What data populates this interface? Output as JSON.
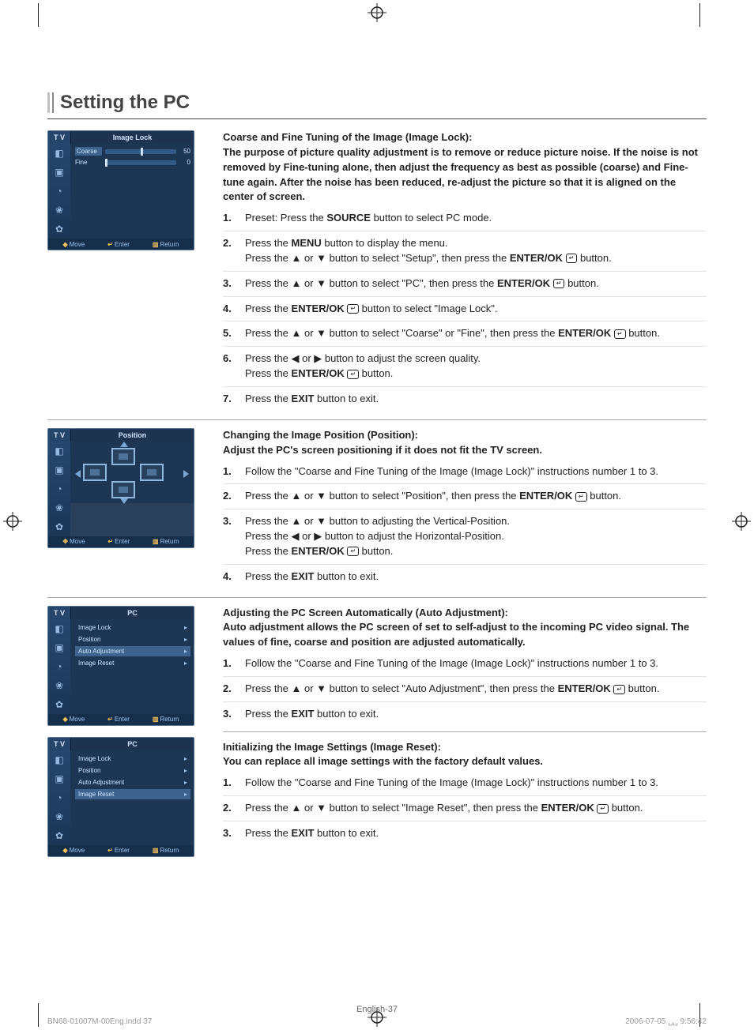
{
  "page": {
    "title": "Setting the PC",
    "footer": "English-37",
    "indd": "BN68-01007M-00Eng.indd   37",
    "timestamp": "2006-07-05   ␣␣ 9:56:42"
  },
  "glyphs": {
    "up": "▲",
    "down": "▼",
    "left": "◀",
    "right": "▶",
    "enter": "↵"
  },
  "tv_common": {
    "tv_label": "T V",
    "foot_move_ud": "Move",
    "foot_move_all": "Move",
    "foot_enter": "Enter",
    "foot_return": "Return",
    "foot_move_sym_ud": "◆",
    "foot_move_sym_all": "✥",
    "foot_enter_sym": "↵",
    "foot_return_sym": "▥"
  },
  "tv1": {
    "title": "Image Lock",
    "rows": [
      {
        "label": "Coarse",
        "value": "50",
        "pos": 50,
        "selected": true
      },
      {
        "label": "Fine",
        "value": "0",
        "pos": 0,
        "selected": false
      }
    ]
  },
  "tv2": {
    "title": "Position"
  },
  "tv3": {
    "title": "PC",
    "items": [
      {
        "label": "Image Lock",
        "selected": false
      },
      {
        "label": "Position",
        "selected": false
      },
      {
        "label": "Auto Adjustment",
        "selected": true
      },
      {
        "label": "Image Reset",
        "selected": false
      }
    ]
  },
  "tv4": {
    "title": "PC",
    "items": [
      {
        "label": "Image Lock",
        "selected": false
      },
      {
        "label": "Position",
        "selected": false
      },
      {
        "label": "Auto Adjustment",
        "selected": false
      },
      {
        "label": "Image Reset",
        "selected": true
      }
    ]
  },
  "sections": [
    {
      "heading": "Coarse and Fine Tuning of the Image (Image Lock):",
      "intro": "The purpose of picture quality adjustment is to remove or reduce picture noise. If the noise is not removed by Fine-tuning alone, then adjust the frequency as best as possible (coarse) and Fine-tune again. After the noise has been reduced, re-adjust the picture so that it is aligned on the center of screen.",
      "steps": [
        {
          "pre": "Preset: Press the ",
          "bold": "SOURCE",
          "post": " button to select PC mode."
        },
        {
          "lines": [
            {
              "pre": "Press the ",
              "bold": "MENU",
              "post": " button to display the menu."
            },
            {
              "pre": "Press the ▲ or ▼ button to select \"Setup\", then press the ",
              "bold": "ENTER/OK",
              "enter": true,
              "post": " button."
            }
          ]
        },
        {
          "pre": "Press the ▲ or ▼ button to select \"PC\", then press the ",
          "bold": "ENTER/OK",
          "enter": true,
          "post": " button."
        },
        {
          "pre": "Press the ",
          "bold": "ENTER/OK",
          "enter": true,
          "post": " button to select \"Image Lock\"."
        },
        {
          "pre": "Press the ▲ or ▼ button to select \"Coarse\" or \"Fine\", then press the ",
          "bold": "ENTER/OK",
          "enter": true,
          "post": " button."
        },
        {
          "lines": [
            {
              "pre": "Press the ◀ or ▶ button to adjust the screen quality."
            },
            {
              "pre": "Press the ",
              "bold": "ENTER/OK",
              "enter": true,
              "post": " button."
            }
          ]
        },
        {
          "pre": "Press the ",
          "bold": "EXIT",
          "post": " button to exit."
        }
      ]
    },
    {
      "heading": "Changing the Image Position (Position):",
      "intro": "Adjust the PC's screen positioning if it does not fit the TV screen.",
      "steps": [
        {
          "pre": "Follow the \"Coarse and Fine Tuning of the Image (Image Lock)\" instructions number 1 to 3."
        },
        {
          "pre": "Press the ▲ or ▼ button to select \"Position\", then press the ",
          "bold": "ENTER/OK",
          "enter": true,
          "post": " button."
        },
        {
          "lines": [
            {
              "pre": "Press the ▲ or ▼ button to adjusting the Vertical-Position."
            },
            {
              "pre": "Press the ◀ or ▶ button to adjust the Horizontal-Position."
            },
            {
              "pre": "Press the ",
              "bold": "ENTER/OK",
              "enter": true,
              "post": " button."
            }
          ]
        },
        {
          "pre": "Press the ",
          "bold": "EXIT",
          "post": " button to exit."
        }
      ]
    },
    {
      "heading": "Adjusting the PC Screen Automatically (Auto Adjustment):",
      "intro": "Auto adjustment allows the PC screen of set to self-adjust to the incoming PC video signal. The values of fine, coarse and position are adjusted automatically.",
      "steps": [
        {
          "pre": "Follow the \"Coarse and Fine Tuning of the Image (Image Lock)\" instructions number 1 to 3."
        },
        {
          "pre": "Press the ▲ or ▼ button to select \"Auto Adjustment\", then press the ",
          "bold": "ENTER/OK",
          "enter": true,
          "post": " button."
        },
        {
          "pre": "Press the ",
          "bold": "EXIT",
          "post": " button to exit."
        }
      ]
    },
    {
      "heading": "Initializing the Image Settings (Image Reset):",
      "intro": "You can replace all image settings with the factory default values.",
      "steps": [
        {
          "pre": "Follow the \"Coarse and Fine Tuning of the Image (Image Lock)\" instructions number 1 to 3."
        },
        {
          "pre": "Press the ▲ or ▼ button to select \"Image Reset\", then press the ",
          "bold": "ENTER/OK",
          "enter": true,
          "post": " button."
        },
        {
          "pre": "Press the ",
          "bold": "EXIT",
          "post": " button to exit."
        }
      ]
    }
  ]
}
